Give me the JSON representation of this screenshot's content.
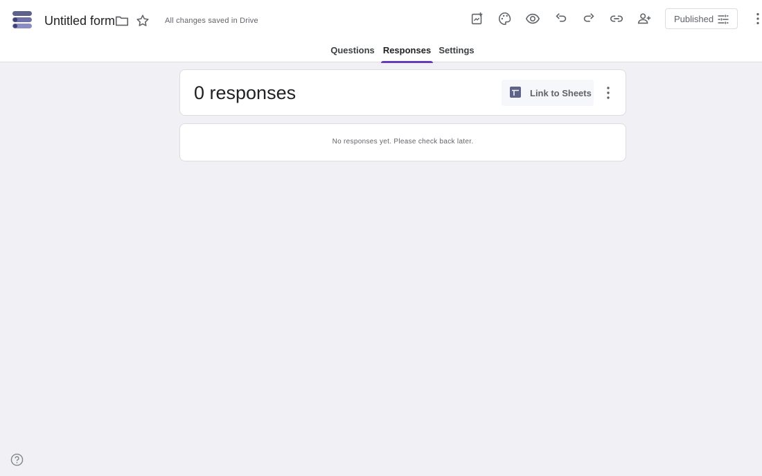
{
  "header": {
    "form_title": "Untitled form",
    "save_status": "All changes saved in Drive",
    "published_label": "Published",
    "icons": [
      "forms-logo-icon",
      "folder-icon",
      "star-icon",
      "addon-icon",
      "palette-icon",
      "preview-eye-icon",
      "undo-icon",
      "redo-icon",
      "link-icon",
      "add-collaborator-icon",
      "tune-icon",
      "more-vert-icon"
    ]
  },
  "tabs": [
    {
      "label": "Questions",
      "active": false
    },
    {
      "label": "Responses",
      "active": true
    },
    {
      "label": "Settings",
      "active": false
    }
  ],
  "responses": {
    "count_label": "0 responses",
    "link_sheets_label": "Link to Sheets",
    "empty_message": "No responses yet. Please check back later."
  },
  "colors": {
    "accent": "#673ab7",
    "background": "#f0f0f5",
    "sheets_bg": "#f6f7fb"
  }
}
